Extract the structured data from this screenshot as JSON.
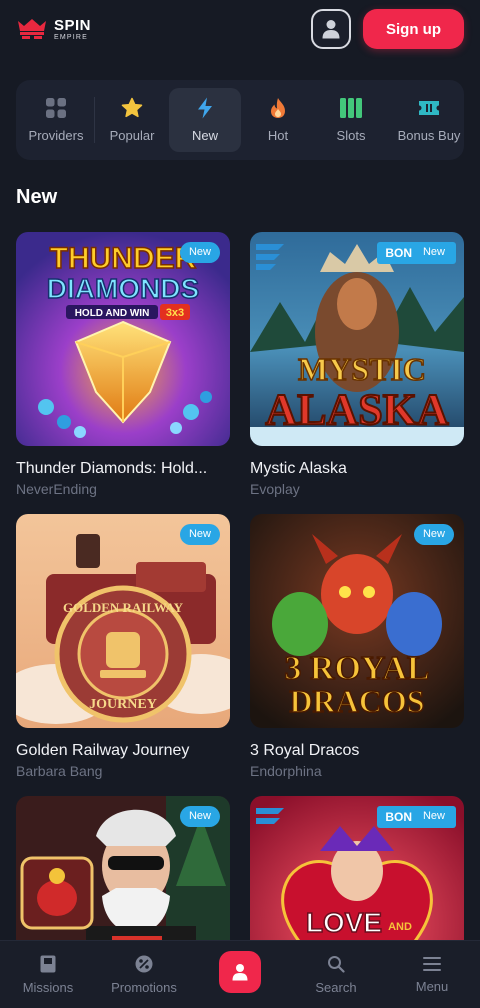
{
  "brand": {
    "name_line1": "SPIN",
    "name_line2": "EMPIRE",
    "accent_color": "#f0274b"
  },
  "header": {
    "signup_label": "Sign up",
    "profile_icon": "user-icon"
  },
  "categories": [
    {
      "label": "Providers",
      "icon": "grid-icon",
      "active": false
    },
    {
      "label": "Popular",
      "icon": "star-icon",
      "active": false
    },
    {
      "label": "New",
      "icon": "lightning-icon",
      "active": true
    },
    {
      "label": "Hot",
      "icon": "flame-icon",
      "active": false
    },
    {
      "label": "Slots",
      "icon": "slots-icon",
      "active": false
    },
    {
      "label": "Bonus Buy",
      "icon": "ticket-icon",
      "active": false
    }
  ],
  "section": {
    "title": "New"
  },
  "games": [
    {
      "name": "Thunder Diamonds: Hold...",
      "provider": "NeverEnding",
      "badge": "New",
      "art_title_1": "THUNDER",
      "art_title_2": "DIAMONDS",
      "art_sub": "HOLD AND WIN",
      "art_tag": "3x3"
    },
    {
      "name": "Mystic Alaska",
      "provider": "Evoplay",
      "badge": "New",
      "bon_tag": "BON",
      "art_title_1": "MYSTIC",
      "art_title_2": "ALASKA"
    },
    {
      "name": "Golden Railway Journey",
      "provider": "Barbara Bang",
      "badge": "New",
      "art_title_1": "GOLDEN RAILWAY",
      "art_title_2": "JOURNEY"
    },
    {
      "name": "3 Royal Dracos",
      "provider": "Endorphina",
      "badge": "New",
      "art_title_1": "3 ROYAL",
      "art_title_2": "DRACOS"
    },
    {
      "name": "",
      "provider": "",
      "badge": "New"
    },
    {
      "name": "",
      "provider": "",
      "badge": "New",
      "bon_tag": "BON",
      "art_title_1": "LOVE",
      "art_title_2": "AND"
    }
  ],
  "bottom_nav": [
    {
      "label": "Missions",
      "icon": "book-icon"
    },
    {
      "label": "Promotions",
      "icon": "percent-icon"
    },
    {
      "label": "",
      "icon": "user-icon"
    },
    {
      "label": "Search",
      "icon": "search-icon"
    },
    {
      "label": "Menu",
      "icon": "menu-icon"
    }
  ]
}
